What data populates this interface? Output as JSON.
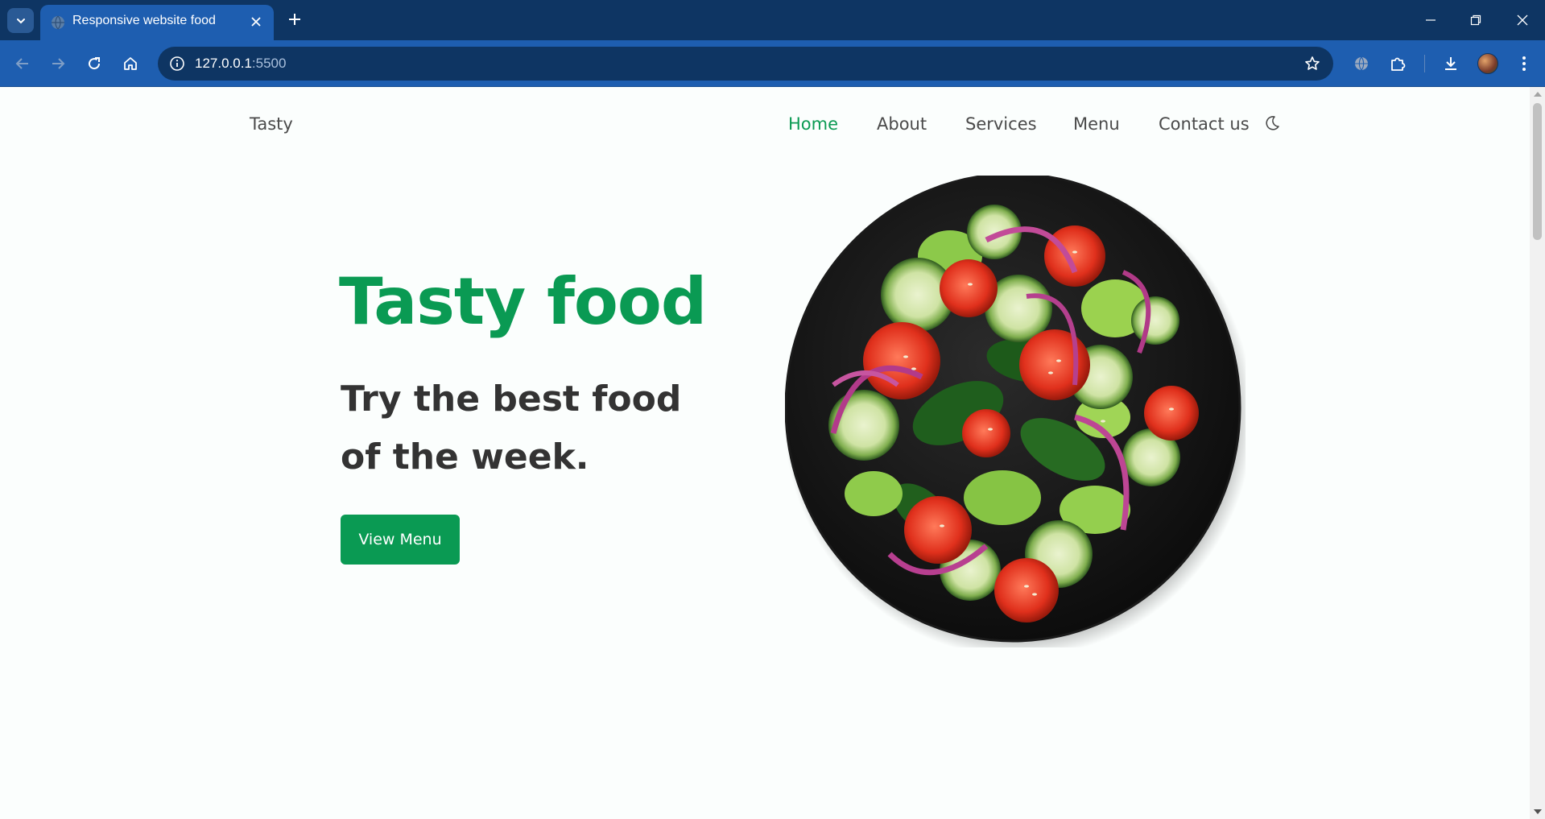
{
  "browser": {
    "tab_title": "Responsive website food",
    "url_host": "127.0.0.1",
    "url_port": ":5500",
    "icons": [
      "tab-search-icon",
      "globe-icon",
      "close-icon",
      "plus-icon",
      "minimize-icon",
      "restore-icon",
      "window-close-icon",
      "back-icon",
      "forward-icon",
      "reload-icon",
      "home-icon",
      "info-icon",
      "star-icon",
      "translate-icon",
      "extensions-icon",
      "download-icon",
      "avatar",
      "kebab-menu-icon"
    ],
    "colors": {
      "tabstrip": "#0e3563",
      "toolbar": "#1e5eb0",
      "omnibox": "#0e3563"
    }
  },
  "page": {
    "logo": "Tasty",
    "nav": [
      {
        "label": "Home",
        "active": true
      },
      {
        "label": "About",
        "active": false
      },
      {
        "label": "Services",
        "active": false
      },
      {
        "label": "Menu",
        "active": false
      },
      {
        "label": "Contact us",
        "active": false
      }
    ],
    "theme_icon": "moon-icon",
    "hero": {
      "title": "Tasty food",
      "subtitle": "Try the best food of the week.",
      "button": "View Menu",
      "image": "salad-bowl"
    },
    "colors": {
      "accent": "#0a9a53",
      "text": "#333333",
      "background": "#fbfefd"
    }
  }
}
